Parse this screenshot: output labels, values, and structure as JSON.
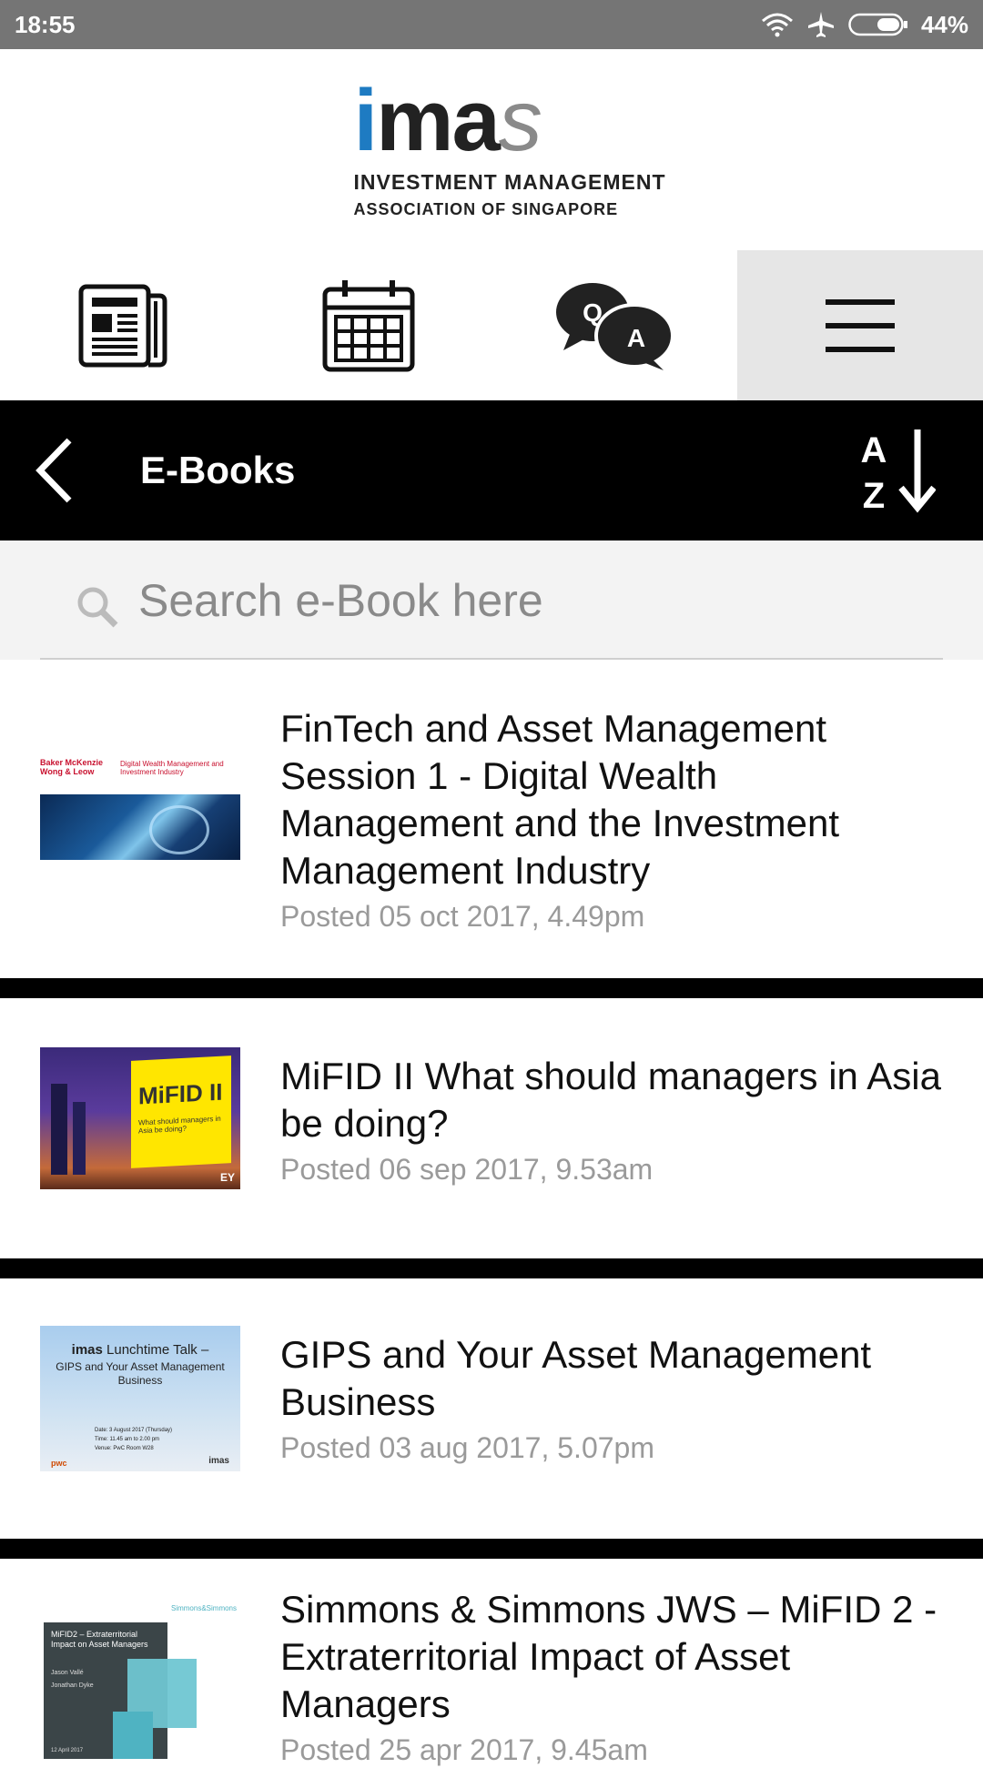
{
  "status_bar": {
    "time": "18:55",
    "battery": "44%"
  },
  "logo": {
    "mark_i": "i",
    "mark_ma": "ma",
    "mark_s": "s",
    "line1": "INVESTMENT MANAGEMENT",
    "line2": "ASSOCIATION OF SINGAPORE"
  },
  "tabs": [
    {
      "icon": "newspaper-icon"
    },
    {
      "icon": "calendar-icon"
    },
    {
      "icon": "qa-chat-icon"
    },
    {
      "icon": "menu-icon",
      "active": true
    }
  ],
  "header": {
    "title": "E-Books"
  },
  "search": {
    "placeholder": "Search e-Book here"
  },
  "items": [
    {
      "title": "FinTech and Asset Management Session 1 - Digital Wealth Management and the Investment Management Industry",
      "date": "Posted 05 oct 2017, 4.49pm",
      "thumb": {
        "logo": "Baker McKenzie Wong & Leow",
        "heading": "Digital Wealth Management and Investment Industry"
      }
    },
    {
      "title": "MiFID II What should managers in Asia be doing?",
      "date": "Posted 06 sep 2017, 9.53am",
      "thumb": {
        "heading": "MiFID II",
        "sub": "What should managers in Asia be doing?",
        "corner": "EY"
      }
    },
    {
      "title": "GIPS and Your Asset Management Business",
      "date": "Posted 03 aug 2017, 5.07pm",
      "thumb": {
        "brand": "imas",
        "heading": "Lunchtime Talk –",
        "sub": "GIPS and Your Asset Management Business",
        "date_label": "Date:",
        "date": "3 August 2017 (Thursday)",
        "time_label": "Time:",
        "time": "11.45 am to 2.00 pm",
        "venue_label": "Venue:",
        "venue": "PwC Room W28",
        "pwc": "pwc",
        "corner": "imas"
      }
    },
    {
      "title": "Simmons & Simmons JWS – MiFID 2 - Extraterritorial Impact of Asset Managers",
      "date": "Posted 25 apr 2017, 9.45am",
      "thumb": {
        "brand": "Simmons&Simmons",
        "heading": "MiFID2 – Extraterritorial Impact on Asset Managers",
        "names": "Jason Vallé",
        "names2": "Jonathan Dyke",
        "date": "12 April 2017"
      }
    }
  ],
  "colors": {
    "accent_blue": "#1e7bc2",
    "black_bar": "#000000",
    "status_grey": "#757575"
  }
}
